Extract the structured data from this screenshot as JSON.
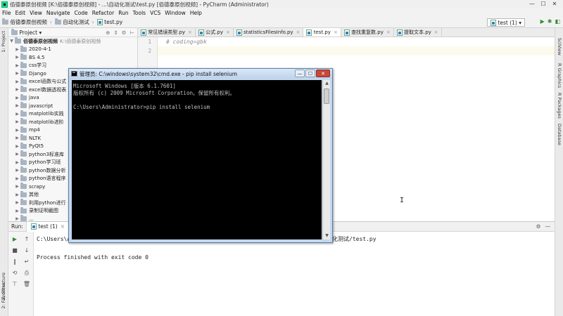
{
  "window": {
    "title": "佰德泰原创视频 [K:\\佰德泰原创视频] - ...\\自动化测试\\test.py [佰德泰原创视频] - PyCharm (Administrator)",
    "controls": [
      "—",
      "☐",
      "✕"
    ]
  },
  "menu": [
    "File",
    "Edit",
    "View",
    "Navigate",
    "Code",
    "Refactor",
    "Run",
    "Tools",
    "VCS",
    "Window",
    "Help"
  ],
  "breadcrumb": [
    "佰德泰原创视频",
    "自动化测试",
    "test.py"
  ],
  "run_config": "test (1)",
  "left_strip": [
    "1: Project",
    "Z: Structure",
    "2: Favorites"
  ],
  "right_strip": [
    "SciView",
    "R Graphics",
    "R Packages",
    "Database"
  ],
  "project_panel": {
    "title": "Project",
    "root": {
      "name": "佰德泰原创视频",
      "path": "K:\\佰德泰原创视频"
    },
    "items": [
      "2020-4-1",
      "BS 4.5",
      "css学习",
      "Django",
      "excel函数与公式",
      "excel数据透视表",
      "java",
      "javascript",
      "matplotlib实践",
      "matplotlib进阶",
      "mp4",
      "NLTK",
      "PyQt5",
      "python3标准库",
      "python学习班",
      "python数据分析",
      "python语言程序",
      "scrapy",
      "其他",
      "利用python进行",
      "录制证明截图",
      "…"
    ]
  },
  "editor": {
    "tabs": [
      {
        "label": "常见错误类型.py",
        "active": false
      },
      {
        "label": "公式.py",
        "active": false
      },
      {
        "label": "statisticsFilesInfo.py",
        "active": false
      },
      {
        "label": "test.py",
        "active": true
      },
      {
        "label": "查找重复数.py",
        "active": false
      },
      {
        "label": "提取文本.py",
        "active": false
      }
    ],
    "line_numbers": [
      "1",
      "2"
    ],
    "lines": [
      "# coding=gbk",
      ""
    ],
    "cursor_glyph": "I"
  },
  "run_panel": {
    "label": "Run:",
    "tab": "test (1)",
    "console": [
      "C:\\Users\\A",
      "",
      "Process finished with exit code 0"
    ],
    "console_tail": "化测试/test.py"
  },
  "cmd_window": {
    "title": "管理员: C:\\windows\\system32\\cmd.exe - pip  install selenium",
    "lines": [
      "Microsoft Windows [版本 6.1.7601]",
      "版权所有 (c) 2009 Microsoft Corporation。保留所有权利。",
      "",
      "C:\\Users\\Administrator>pip install selenium"
    ]
  }
}
